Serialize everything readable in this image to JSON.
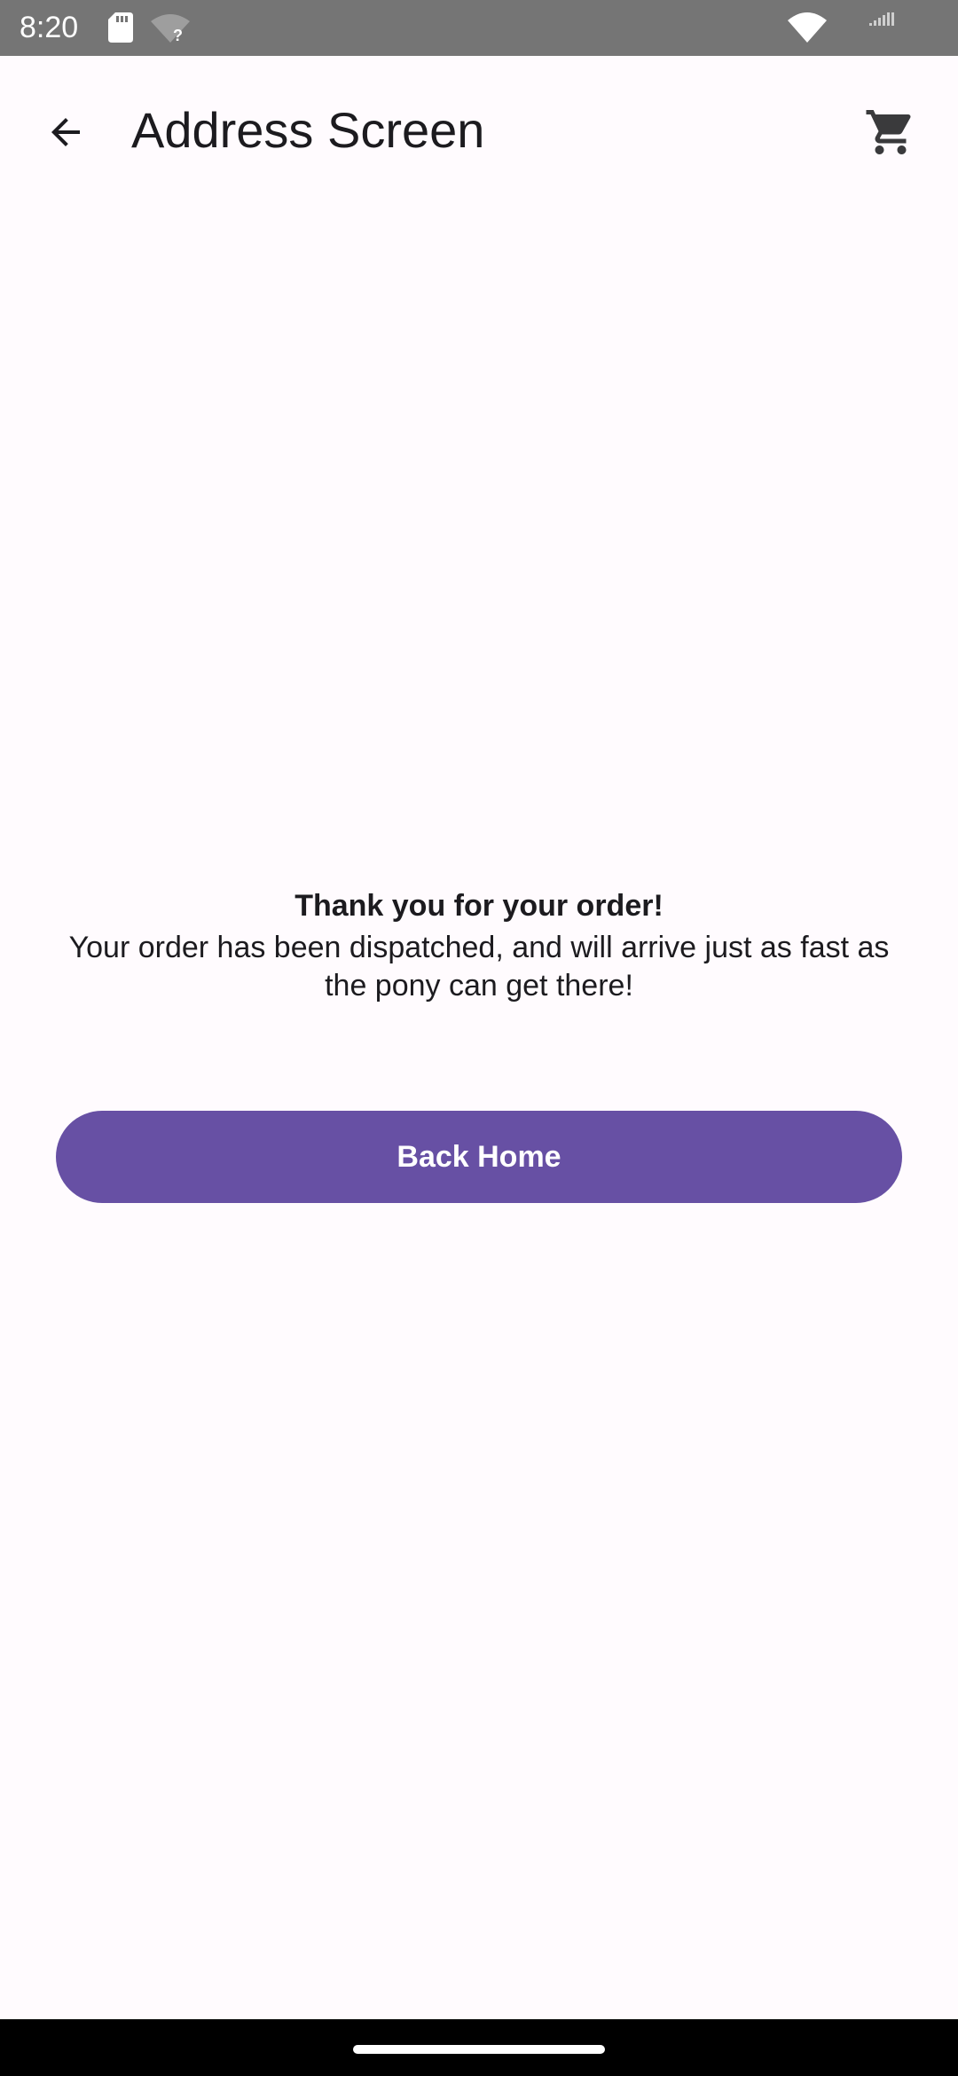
{
  "status_bar": {
    "time": "8:20",
    "icons": [
      "sd-card-icon",
      "wifi-unknown-icon",
      "wifi-icon",
      "signal-icon"
    ],
    "background_color": "#757575"
  },
  "app_bar": {
    "title": "Address Screen",
    "back_icon": "arrow-back-icon",
    "cart_icon": "shopping-cart-icon"
  },
  "confirmation": {
    "title": "Thank you for your order!",
    "line1": "Your order has been dispatched, and will arrive just as fast as",
    "line2": "the pony can get there!"
  },
  "actions": {
    "back_home_label": "Back Home",
    "accent_color": "#6750a4"
  },
  "nav_bar": {
    "handle": "home-gesture-handle"
  }
}
